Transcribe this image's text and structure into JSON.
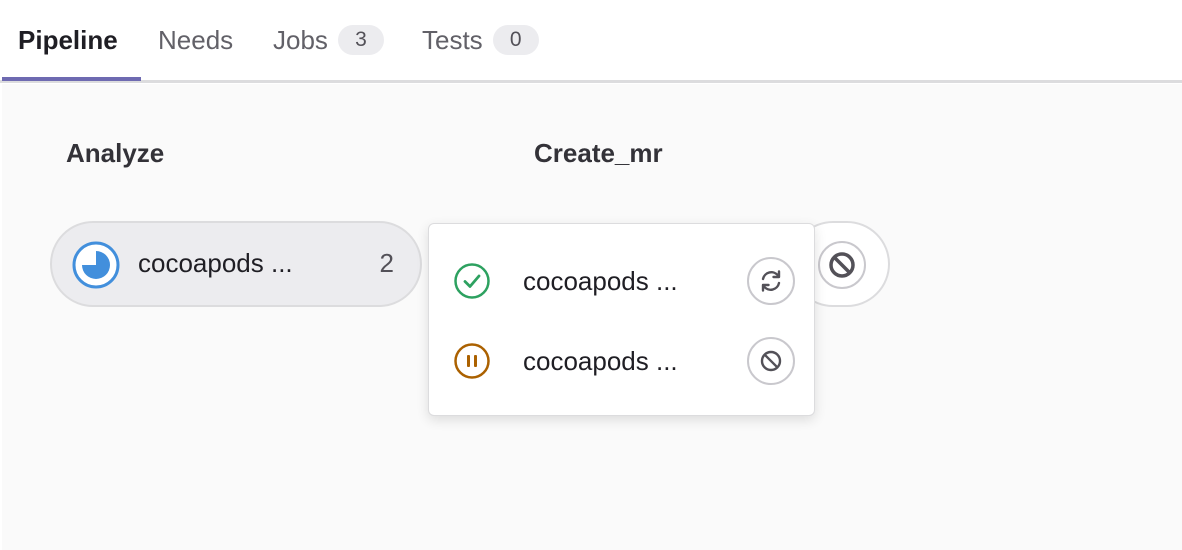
{
  "tabs": [
    {
      "label": "Pipeline",
      "active": true
    },
    {
      "label": "Needs",
      "active": false
    },
    {
      "label": "Jobs",
      "badge": "3",
      "active": false
    },
    {
      "label": "Tests",
      "badge": "0",
      "active": false
    }
  ],
  "stages": [
    {
      "title": "Analyze",
      "group": {
        "name": "cocoapods ...",
        "count": "2",
        "status_icon": "running-status-icon",
        "status_color": "#428fdc"
      }
    },
    {
      "title": "Create_mr",
      "action_icon": "cancel-icon",
      "dropdown": [
        {
          "name": "cocoapods ...",
          "status_icon": "success-status-icon",
          "status_color": "#2da160",
          "action_icon": "retry-icon"
        },
        {
          "name": "cocoapods ...",
          "status_icon": "manual-paused-status-icon",
          "status_color": "#ab6100",
          "action_icon": "cancel-icon"
        }
      ]
    }
  ],
  "colors": {
    "tab_active_underline": "#6e6ab1",
    "background": "#fafafa",
    "icon_gray": "#535158"
  }
}
